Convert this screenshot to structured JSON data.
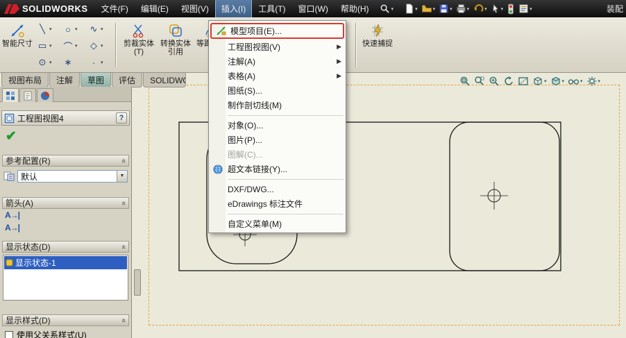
{
  "titlebar": {
    "logo_text": "SOLIDWORKS",
    "right_label": "装配",
    "menus": [
      {
        "label": "文件(F)"
      },
      {
        "label": "编辑(E)"
      },
      {
        "label": "视图(V)"
      },
      {
        "label": "插入(I)",
        "active": true
      },
      {
        "label": "工具(T)"
      },
      {
        "label": "窗口(W)"
      },
      {
        "label": "帮助(H)"
      }
    ]
  },
  "ribbon": {
    "smart_dimension_label": "智能尺寸",
    "trim_label": "剪裁实体(T)",
    "convert_label": "转换实体引用",
    "offset_label": "等距实体",
    "quick_snap_label": "快速捕捉"
  },
  "command_tabs": {
    "items": [
      {
        "label": "视图布局"
      },
      {
        "label": "注解"
      },
      {
        "label": "草图",
        "active": true
      },
      {
        "label": "评估"
      },
      {
        "label": "SOLIDWORKS 插件"
      }
    ]
  },
  "insert_menu": {
    "highlight_color": "#d93a2b",
    "items": [
      {
        "label": "模型项目(E)...",
        "highlighted": true
      },
      {
        "label": "工程图视图(V)",
        "submenu": true
      },
      {
        "label": "注解(A)",
        "submenu": true
      },
      {
        "label": "表格(A)",
        "submenu": true
      },
      {
        "label": "图纸(S)..."
      },
      {
        "label": "制作剖切线(M)"
      },
      {
        "label": "对象(O)..."
      },
      {
        "label": "图片(P)..."
      },
      {
        "label": "图解(C)...",
        "disabled": true
      },
      {
        "label": "超文本链接(Y)...",
        "icon": "globe"
      },
      {
        "label": "DXF/DWG..."
      },
      {
        "label": "eDrawings 标注文件"
      },
      {
        "label": "自定义菜单(M)"
      }
    ]
  },
  "property_manager": {
    "title": "工程图视图4",
    "help_label": "?",
    "reference_config": {
      "header": "参考配置(R)",
      "value": "默认"
    },
    "arrows": {
      "header": "箭头(A)",
      "glyph": "A→|"
    },
    "display_state": {
      "header": "显示状态(D)",
      "items": [
        {
          "label": "显示状态-1",
          "selected": true
        }
      ]
    },
    "display_style": {
      "header": "显示样式(D)",
      "checkbox_label": "使用父关系样式(U)",
      "checked": false
    }
  },
  "canvas": {
    "sheet_border_color": "#e8a33d",
    "background": "#ebe9da"
  },
  "colors": {
    "titlebar_black": "#1b1b1b",
    "toolbar_gray": "#d8d4c6",
    "selection_blue": "#2e5fc0",
    "logo_red": "#cf1f2c",
    "active_tab_teal": "#93b2a8"
  }
}
